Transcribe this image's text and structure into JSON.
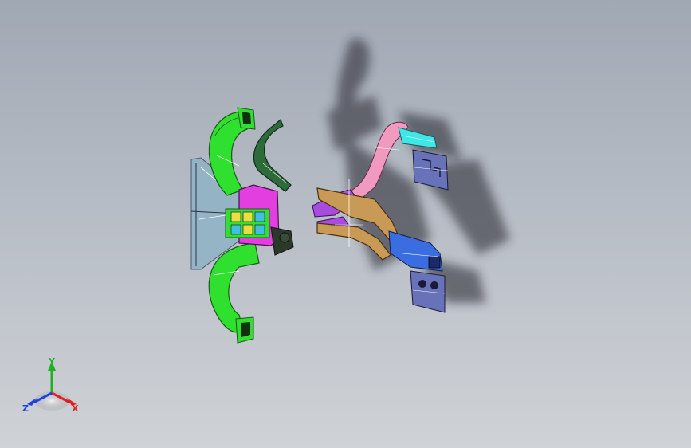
{
  "viewport": {
    "background_top": "#a0a8b3",
    "background_bottom": "#cfd2d6"
  },
  "model": {
    "parts": [
      {
        "name": "upper-duct",
        "color": "#2fe02f"
      },
      {
        "name": "lower-duct",
        "color": "#2fe02f"
      },
      {
        "name": "dark-green-duct",
        "color": "#2e6b3a"
      },
      {
        "name": "center-housing",
        "color": "#e23ee0"
      },
      {
        "name": "left-vent-panel",
        "color": "#8fb3c6"
      },
      {
        "name": "pink-duct",
        "color": "#f09ac0"
      },
      {
        "name": "cyan-duct",
        "color": "#3ee8e8"
      },
      {
        "name": "tan-manifold",
        "color": "#c89a55"
      },
      {
        "name": "purple-connector",
        "color": "#a84ce0"
      },
      {
        "name": "blue-duct",
        "color": "#3a6de0"
      },
      {
        "name": "blue-vent-upper",
        "color": "#6872b8"
      },
      {
        "name": "blue-vent-lower",
        "color": "#6872b8"
      }
    ]
  },
  "triad": {
    "x_label": "X",
    "y_label": "Y",
    "z_label": "Z",
    "x_color": "#e02020",
    "y_color": "#20b020",
    "z_color": "#2040e0"
  }
}
